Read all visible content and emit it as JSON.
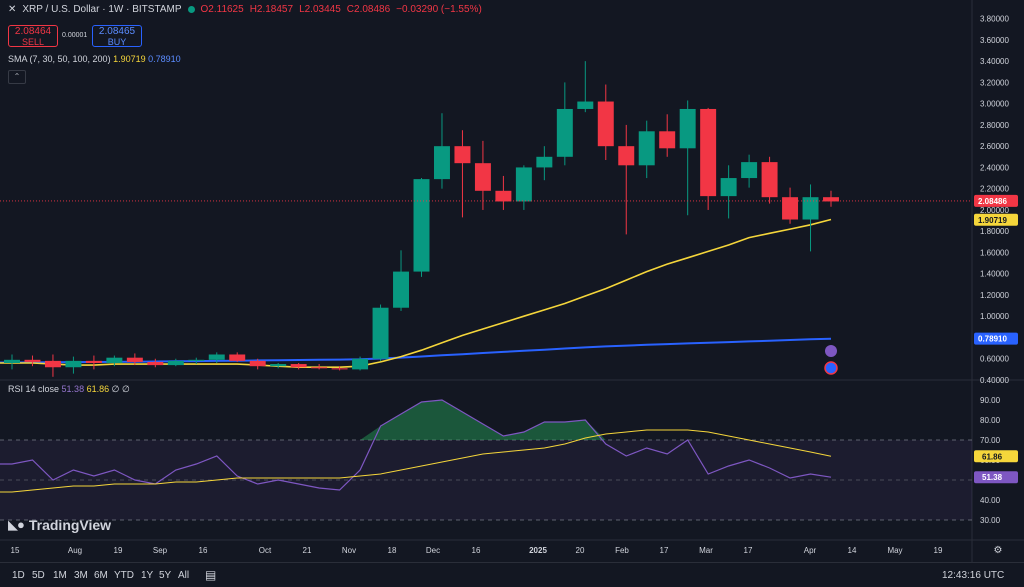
{
  "header": {
    "symbol": "XRP / U.S. Dollar · 1W · BITSTAMP",
    "open": "O2.11625",
    "high": "H2.18457",
    "low": "L2.03445",
    "close": "C2.08486",
    "change": "−0.03290 (−1.55%)"
  },
  "trade": {
    "sell_price": "2.08464",
    "sell_label": "SELL",
    "buy_price": "2.08465",
    "buy_label": "BUY",
    "spread": "0.00001"
  },
  "sma_legend": {
    "label": "SMA (7, 30, 50, 100, 200)",
    "v1": "1.90719",
    "v2": "0.78910"
  },
  "rsi_legend": {
    "label": "RSI 14 close",
    "v1": "51.38",
    "v2": "61.86",
    "v3": "∅",
    "v4": "∅"
  },
  "brand": "TradingView",
  "timeframes": [
    "1D",
    "5D",
    "1M",
    "3M",
    "6M",
    "YTD",
    "1Y",
    "5Y",
    "All"
  ],
  "clock": "12:43:16 UTC",
  "colors": {
    "up": "#089981",
    "down": "#f23645",
    "sma_short": "#f5d63b",
    "sma_long": "#2962ff",
    "rsi": "#7e57c2",
    "rsi_ma": "#f5d63b"
  },
  "chart_data": [
    {
      "type": "candlestick",
      "price_axis": [
        "3.80000",
        "3.60000",
        "3.40000",
        "3.20000",
        "3.00000",
        "2.80000",
        "2.60000",
        "2.40000",
        "2.20000",
        "2.00000",
        "1.80000",
        "1.60000",
        "1.40000",
        "1.20000",
        "1.00000",
        "0.80000",
        "0.60000",
        "0.40000"
      ],
      "price_axis_values": [
        3.8,
        3.6,
        3.4,
        3.2,
        3.0,
        2.8,
        2.6,
        2.4,
        2.2,
        2.0,
        1.8,
        1.6,
        1.4,
        1.2,
        1.0,
        0.8,
        0.6,
        0.4
      ],
      "ylim": [
        0.4,
        3.9
      ],
      "x_labels": [
        "15",
        "Aug",
        "19",
        "Sep",
        "16",
        "Oct",
        "21",
        "Nov",
        "18",
        "Dec",
        "16",
        "2025",
        "20",
        "Feb",
        "17",
        "Mar",
        "17",
        "Apr",
        "14",
        "May",
        "19"
      ],
      "candles": [
        {
          "o": 0.56,
          "h": 0.64,
          "l": 0.5,
          "c": 0.59
        },
        {
          "o": 0.59,
          "h": 0.63,
          "l": 0.53,
          "c": 0.57
        },
        {
          "o": 0.58,
          "h": 0.64,
          "l": 0.43,
          "c": 0.52
        },
        {
          "o": 0.52,
          "h": 0.62,
          "l": 0.46,
          "c": 0.58
        },
        {
          "o": 0.58,
          "h": 0.63,
          "l": 0.5,
          "c": 0.56
        },
        {
          "o": 0.56,
          "h": 0.63,
          "l": 0.53,
          "c": 0.61
        },
        {
          "o": 0.61,
          "h": 0.65,
          "l": 0.54,
          "c": 0.57
        },
        {
          "o": 0.57,
          "h": 0.6,
          "l": 0.52,
          "c": 0.54
        },
        {
          "o": 0.54,
          "h": 0.6,
          "l": 0.53,
          "c": 0.58
        },
        {
          "o": 0.58,
          "h": 0.61,
          "l": 0.55,
          "c": 0.59
        },
        {
          "o": 0.59,
          "h": 0.66,
          "l": 0.56,
          "c": 0.64
        },
        {
          "o": 0.64,
          "h": 0.66,
          "l": 0.57,
          "c": 0.58
        },
        {
          "o": 0.58,
          "h": 0.6,
          "l": 0.5,
          "c": 0.53
        },
        {
          "o": 0.53,
          "h": 0.56,
          "l": 0.51,
          "c": 0.55
        },
        {
          "o": 0.55,
          "h": 0.56,
          "l": 0.5,
          "c": 0.52
        },
        {
          "o": 0.52,
          "h": 0.55,
          "l": 0.5,
          "c": 0.51
        },
        {
          "o": 0.51,
          "h": 0.53,
          "l": 0.49,
          "c": 0.5
        },
        {
          "o": 0.5,
          "h": 0.62,
          "l": 0.49,
          "c": 0.6
        },
        {
          "o": 0.6,
          "h": 1.11,
          "l": 0.58,
          "c": 1.08
        },
        {
          "o": 1.08,
          "h": 1.62,
          "l": 1.05,
          "c": 1.42
        },
        {
          "o": 1.42,
          "h": 2.3,
          "l": 1.37,
          "c": 2.29
        },
        {
          "o": 2.29,
          "h": 2.91,
          "l": 2.2,
          "c": 2.6
        },
        {
          "o": 2.6,
          "h": 2.75,
          "l": 1.93,
          "c": 2.44
        },
        {
          "o": 2.44,
          "h": 2.65,
          "l": 2.0,
          "c": 2.18
        },
        {
          "o": 2.18,
          "h": 2.32,
          "l": 2.0,
          "c": 2.08
        },
        {
          "o": 2.08,
          "h": 2.42,
          "l": 2.0,
          "c": 2.4
        },
        {
          "o": 2.4,
          "h": 2.6,
          "l": 2.28,
          "c": 2.5
        },
        {
          "o": 2.5,
          "h": 3.2,
          "l": 2.42,
          "c": 2.95
        },
        {
          "o": 2.95,
          "h": 3.4,
          "l": 2.92,
          "c": 3.02
        },
        {
          "o": 3.02,
          "h": 3.18,
          "l": 2.47,
          "c": 2.6
        },
        {
          "o": 2.6,
          "h": 2.8,
          "l": 1.77,
          "c": 2.42
        },
        {
          "o": 2.42,
          "h": 2.84,
          "l": 2.3,
          "c": 2.74
        },
        {
          "o": 2.74,
          "h": 2.9,
          "l": 2.5,
          "c": 2.58
        },
        {
          "o": 2.58,
          "h": 3.03,
          "l": 1.95,
          "c": 2.95
        },
        {
          "o": 2.95,
          "h": 2.96,
          "l": 2.0,
          "c": 2.13
        },
        {
          "o": 2.13,
          "h": 2.42,
          "l": 1.92,
          "c": 2.3
        },
        {
          "o": 2.3,
          "h": 2.52,
          "l": 2.21,
          "c": 2.45
        },
        {
          "o": 2.45,
          "h": 2.5,
          "l": 2.06,
          "c": 2.12
        },
        {
          "o": 2.12,
          "h": 2.21,
          "l": 1.87,
          "c": 1.91
        },
        {
          "o": 1.91,
          "h": 2.24,
          "l": 1.61,
          "c": 2.12
        },
        {
          "o": 2.12,
          "h": 2.18,
          "l": 2.03,
          "c": 2.08
        }
      ],
      "sma_short": [
        0.56,
        0.56,
        0.55,
        0.54,
        0.54,
        0.55,
        0.55,
        0.55,
        0.55,
        0.55,
        0.55,
        0.55,
        0.54,
        0.53,
        0.52,
        0.52,
        0.52,
        0.53,
        0.57,
        0.62,
        0.68,
        0.75,
        0.82,
        0.88,
        0.94,
        1.0,
        1.06,
        1.12,
        1.19,
        1.26,
        1.34,
        1.42,
        1.49,
        1.55,
        1.61,
        1.67,
        1.74,
        1.78,
        1.82,
        1.86,
        1.91
      ],
      "sma_long": [
        0.565,
        0.566,
        0.567,
        0.568,
        0.569,
        0.57,
        0.572,
        0.574,
        0.576,
        0.578,
        0.58,
        0.582,
        0.584,
        0.586,
        0.588,
        0.59,
        0.592,
        0.595,
        0.602,
        0.611,
        0.621,
        0.632,
        0.643,
        0.654,
        0.664,
        0.675,
        0.685,
        0.696,
        0.707,
        0.716,
        0.724,
        0.731,
        0.738,
        0.744,
        0.751,
        0.757,
        0.763,
        0.769,
        0.776,
        0.783,
        0.789
      ],
      "price_marks": [
        {
          "label": "2.08486",
          "value": 2.08486,
          "color": "#f23645"
        },
        {
          "label": "1.90719",
          "value": 1.90719,
          "color": "#f5d63b"
        },
        {
          "label": "0.78910",
          "value": 0.7891,
          "color": "#2962ff"
        }
      ]
    },
    {
      "type": "line",
      "name": "RSI 14 close",
      "ylim": [
        20,
        100
      ],
      "axis": [
        "90.00",
        "80.00",
        "70.00",
        "60.00",
        "50.00",
        "40.00",
        "30.00"
      ],
      "axis_values": [
        90,
        80,
        70,
        60,
        50,
        40,
        30
      ],
      "band": [
        30,
        70
      ],
      "rsi": [
        58,
        60,
        50,
        55,
        52,
        55,
        50,
        48,
        55,
        58,
        62,
        52,
        48,
        50,
        48,
        46,
        45,
        55,
        77,
        83,
        89,
        90,
        84,
        78,
        72,
        74,
        79,
        79,
        80,
        68,
        62,
        66,
        63,
        70,
        53,
        57,
        60,
        56,
        51,
        53,
        51.38
      ],
      "rsi_ma": [
        44,
        45,
        46,
        47,
        47,
        48,
        48,
        48,
        49,
        49,
        50,
        51,
        51,
        51,
        51,
        51,
        51,
        52,
        53,
        55,
        57,
        59,
        61,
        63,
        64,
        65,
        66,
        68,
        71,
        73,
        74,
        75,
        75,
        75,
        74,
        72,
        70,
        68,
        66,
        64,
        61.86
      ],
      "marks": [
        {
          "label": "61.86",
          "value": 61.86,
          "color": "#f5d63b"
        },
        {
          "label": "51.38",
          "value": 51.38,
          "color": "#7e57c2"
        }
      ]
    }
  ]
}
